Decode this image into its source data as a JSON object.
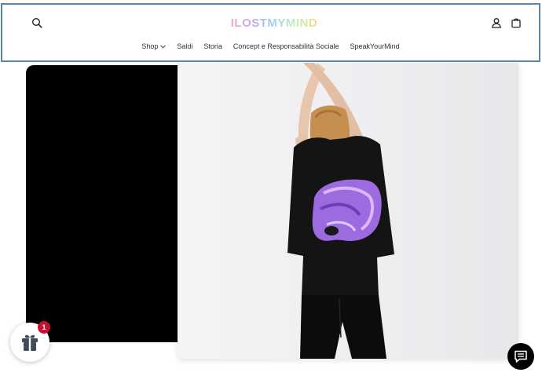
{
  "header": {
    "logo_text": "ILOSTMYMIND",
    "icons": {
      "search": "search-icon",
      "account": "user-icon",
      "cart": "bag-icon"
    }
  },
  "nav": {
    "items": [
      {
        "label": "Shop",
        "has_dropdown": true
      },
      {
        "label": "Saldi"
      },
      {
        "label": "Storia"
      },
      {
        "label": "Concept e Responsabilità Sociale"
      },
      {
        "label": "SpeakYourMind"
      }
    ]
  },
  "product_image": {
    "subject": "woman-back-black-tshirt-purple-print"
  },
  "gift_widget": {
    "icon": "gift-icon",
    "badge_count": "1",
    "badge_color": "#c8102e"
  },
  "chat_widget": {
    "icon": "chat-icon"
  },
  "colors": {
    "header_border": "#5a86ad",
    "panel": "#000000",
    "text": "#333333"
  }
}
